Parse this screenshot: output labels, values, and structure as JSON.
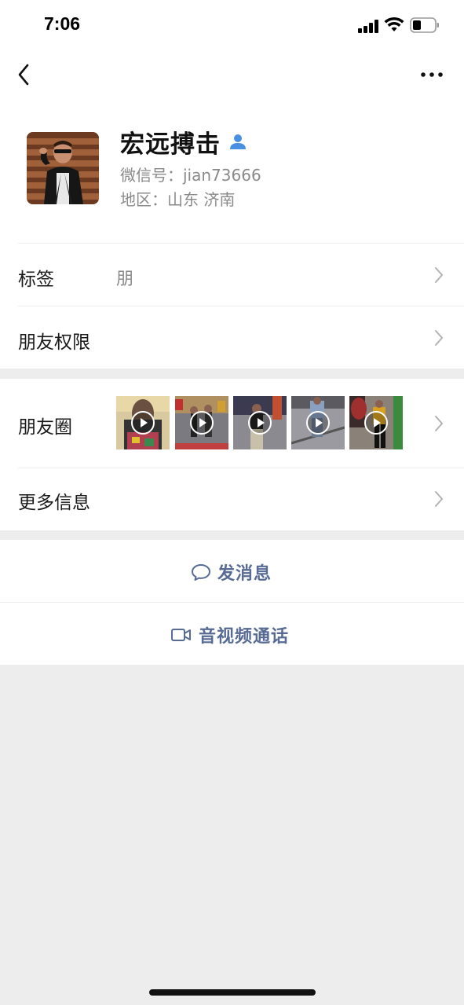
{
  "status_bar": {
    "time": "7:06"
  },
  "nav": {
    "back_icon": "chevron-left-icon",
    "more_icon": "more-horizontal-icon"
  },
  "profile": {
    "name": "宏远搏击",
    "wechat_id": "微信号：jian73666",
    "region": "地区：山东 济南",
    "badge_icon": "contact-person-icon"
  },
  "rows": {
    "tags": {
      "label": "标签",
      "value": "朋"
    },
    "permissions": {
      "label": "朋友权限"
    },
    "moments": {
      "label": "朋友圈",
      "thumbnail_count": 5
    },
    "more_info": {
      "label": "更多信息"
    }
  },
  "actions": {
    "message": {
      "label": "发消息",
      "icon": "chat-bubble-icon"
    },
    "video_call": {
      "label": "音视频通话",
      "icon": "video-camera-icon"
    }
  },
  "colors": {
    "link_blue": "#576b95",
    "background": "#ededed",
    "badge_blue": "#4a90e2"
  }
}
